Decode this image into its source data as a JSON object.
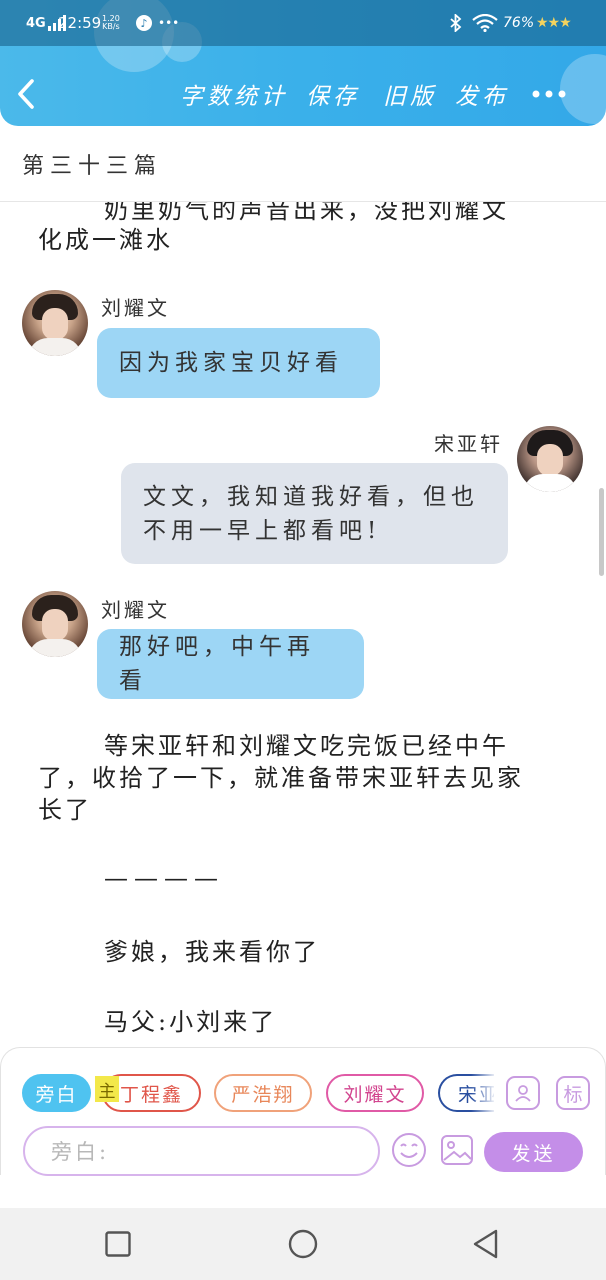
{
  "status_bar": {
    "network": "4G",
    "time": "22:59",
    "speed_value": "1.20",
    "speed_unit": "KB/s",
    "more": "•••",
    "battery": "76%"
  },
  "toolbar": {
    "word_count": "字数统计",
    "save": "保存",
    "old_version": "旧版",
    "publish": "发布"
  },
  "chapter": {
    "title": "第三十三篇"
  },
  "story": {
    "narration_top": [
      "奶里奶气的声音出来，没把刘耀文",
      "化成一滩水"
    ],
    "messages": [
      {
        "speaker": "刘耀文",
        "lines": [
          "因为我家宝贝好看"
        ]
      },
      {
        "speaker": "宋亚轩",
        "lines": [
          "文文，我知道我好看，但也",
          "不用一早上都看吧!"
        ]
      },
      {
        "speaker": "刘耀文",
        "lines": [
          "那好吧，中午再看"
        ]
      }
    ],
    "narration_mid": [
      "等宋亚轩和刘耀文吃完饭已经中午",
      "了，收拾了一下，就准备带宋亚轩去见家",
      "长了"
    ],
    "divider": "————",
    "line_1": "爹娘，我来看你了",
    "line_2": "马父:小刘来了"
  },
  "composer": {
    "chips": [
      "旁白",
      "丁程鑫",
      "严浩翔",
      "刘耀文",
      "宋亚轩"
    ],
    "highlight_tag": "主",
    "tag_button": "标",
    "input_placeholder": "旁白:",
    "send_label": "发送"
  },
  "colors": {
    "header": "#3ab0ea",
    "bubble_blue": "#9dd6f5",
    "bubble_grey": "#dfe4ec",
    "chip_active": "#4fc3f0",
    "send": "#c48ee8",
    "chip_dingchengxin": "#e0564a",
    "chip_yanhaoxiang": "#f0a27a",
    "chip_liuyaowen": "#e05aa6",
    "chip_songyaxuan": "#2a4fa0"
  },
  "icons": [
    "back-icon",
    "bluetooth-icon",
    "wifi-icon",
    "more-icon",
    "avatar-icon",
    "emoji-icon",
    "image-icon",
    "square-nav-icon",
    "circle-nav-icon",
    "triangle-nav-icon"
  ]
}
